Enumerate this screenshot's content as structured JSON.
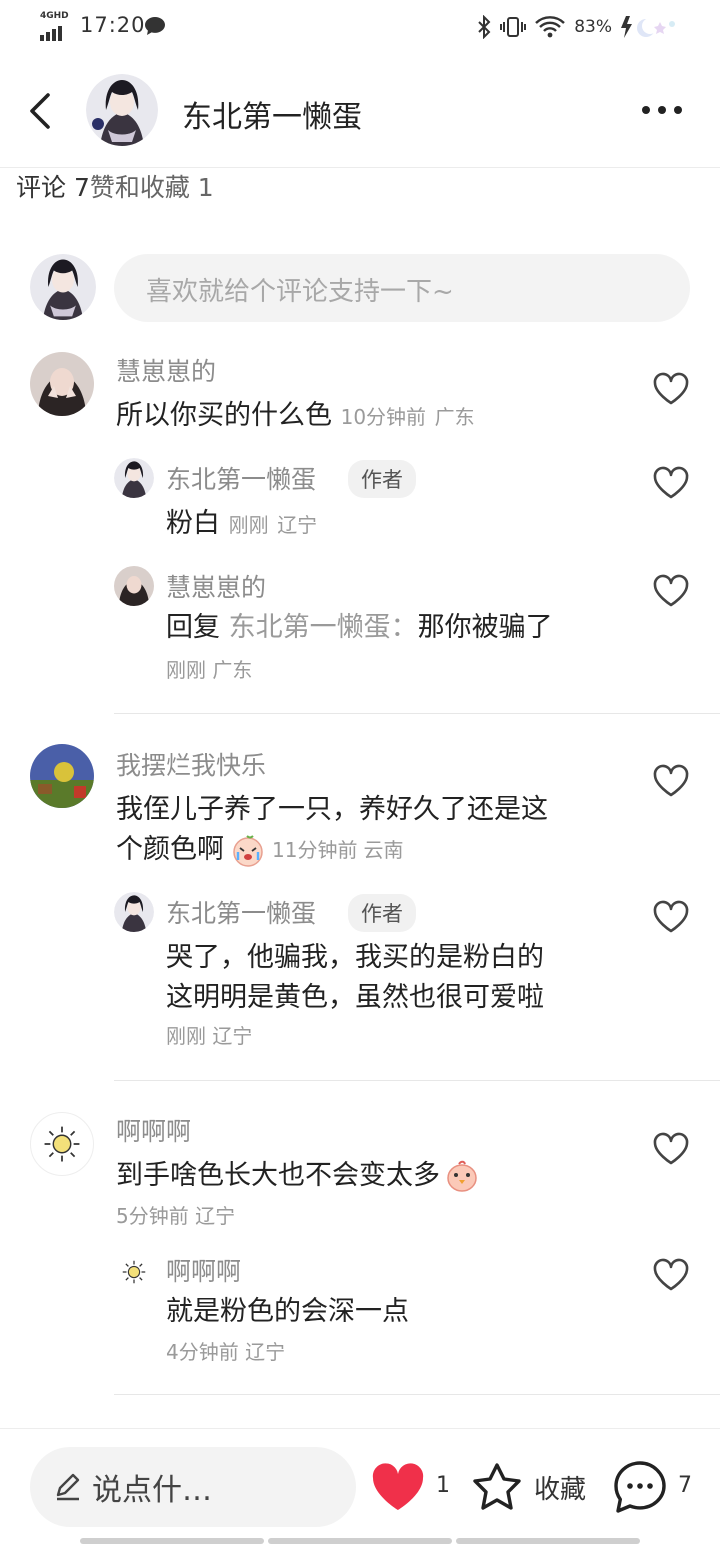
{
  "status_bar": {
    "network": "4GHD",
    "time": "17:20",
    "battery": "83%"
  },
  "header": {
    "title": "东北第一懒蛋"
  },
  "counts": {
    "comments": "评论 7",
    "likes_saves": "赞和收藏 1"
  },
  "composer": {
    "placeholder": "喜欢就给个评论支持一下~"
  },
  "comments": [
    {
      "user": "慧崽崽的",
      "text": "所以你买的什么色",
      "time": "10分钟前",
      "location": "广东",
      "replies": [
        {
          "user": "东北第一懒蛋",
          "tag": "作者",
          "text": "粉白",
          "time": "刚刚",
          "location": "辽宁"
        },
        {
          "user": "慧崽崽的",
          "reply_prefix": "回复",
          "reply_to": "东北第一懒蛋：",
          "text": "那你被骗了",
          "time": "刚刚",
          "location": "广东"
        }
      ]
    },
    {
      "user": "我摆烂我快乐",
      "text_line1": "我侄儿子养了一只，养好久了还是这",
      "text_line2": "个颜色啊",
      "time": "11分钟前",
      "location": "云南",
      "replies": [
        {
          "user": "东北第一懒蛋",
          "tag": "作者",
          "text_line1": "哭了，他骗我，我买的是粉白的",
          "text_line2": "这明明是黄色，虽然也很可爱啦",
          "time": "刚刚",
          "location": "辽宁"
        }
      ]
    },
    {
      "user": "啊啊啊",
      "text": "到手啥色长大也不会变太多",
      "time": "5分钟前",
      "location": "辽宁",
      "replies": [
        {
          "user": "啊啊啊",
          "text": "就是粉色的会深一点",
          "time": "4分钟前",
          "location": "辽宁"
        }
      ]
    }
  ],
  "bottom_bar": {
    "input_label": "说点什…",
    "like_count": "1",
    "save_label": "收藏",
    "comment_count": "7"
  },
  "colors": {
    "like": "#f0304a",
    "muted_text": "#8c8c8c",
    "pill_bg": "#f3f3f3"
  },
  "icons": [
    "back-arrow-icon",
    "more-icon",
    "heart-outline-icon",
    "heart-filled-icon",
    "star-icon",
    "comment-bubble-icon",
    "pencil-icon",
    "crying-emoji-icon",
    "chick-emoji-icon",
    "sun-icon"
  ]
}
